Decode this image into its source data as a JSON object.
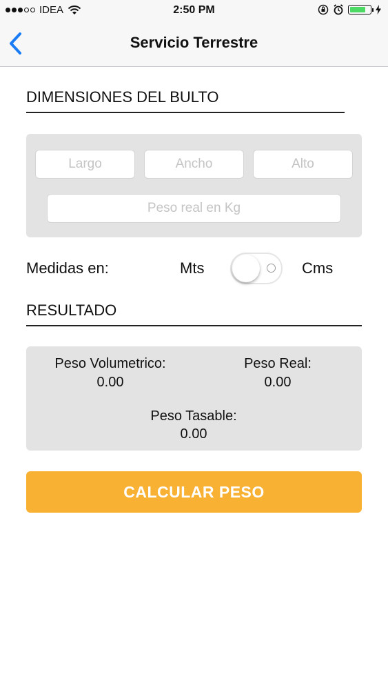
{
  "status_bar": {
    "carrier": "IDEA",
    "time": "2:50 PM",
    "signal_bars": 3,
    "signal_total": 5,
    "battery_level": 0.8,
    "battery_color": "#4cd964"
  },
  "nav": {
    "title": "Servicio Terrestre",
    "back_icon": "chevron-left-icon",
    "accent": "#1a7cf5"
  },
  "dimensions": {
    "title": "DIMENSIONES DEL BULTO",
    "largo_placeholder": "Largo",
    "ancho_placeholder": "Ancho",
    "alto_placeholder": "Alto",
    "peso_placeholder": "Peso real en Kg"
  },
  "units": {
    "label": "Medidas en:",
    "left_option": "Mts",
    "right_option": "Cms",
    "toggle_on": false
  },
  "result": {
    "title": "RESULTADO",
    "volumetric_label": "Peso Volumetrico:",
    "volumetric_value": "0.00",
    "real_label": "Peso Real:",
    "real_value": "0.00",
    "taxable_label": "Peso Tasable:",
    "taxable_value": "0.00"
  },
  "action": {
    "calculate_label": "CALCULAR PESO",
    "color": "#f8b133"
  }
}
